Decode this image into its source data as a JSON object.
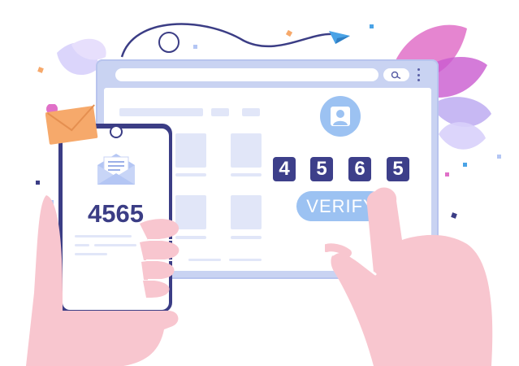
{
  "colors": {
    "navy": "#3b3d85",
    "browser_frame": "#c9d3f2",
    "skeleton": "#e1e6f8",
    "light_blue": "#9cc2f2",
    "envelope_orange": "#f6a96b",
    "skin": "#f8c6cf",
    "leaf_pink": "#e070c8"
  },
  "browser": {
    "icons": {
      "search": "search-icon",
      "menu": "kebab-menu-icon",
      "profile": "user-avatar-icon"
    },
    "otp_digits": [
      "4",
      "5",
      "6",
      "5"
    ],
    "verify_label": "VERIFY"
  },
  "phone": {
    "otp_code": "4565",
    "icons": {
      "email": "open-envelope-icon",
      "camera": "front-camera-icon"
    }
  },
  "decorations": {
    "icons": [
      "email-envelope-icon",
      "paper-plane-icon",
      "leaf-icon",
      "hand-icon"
    ]
  }
}
